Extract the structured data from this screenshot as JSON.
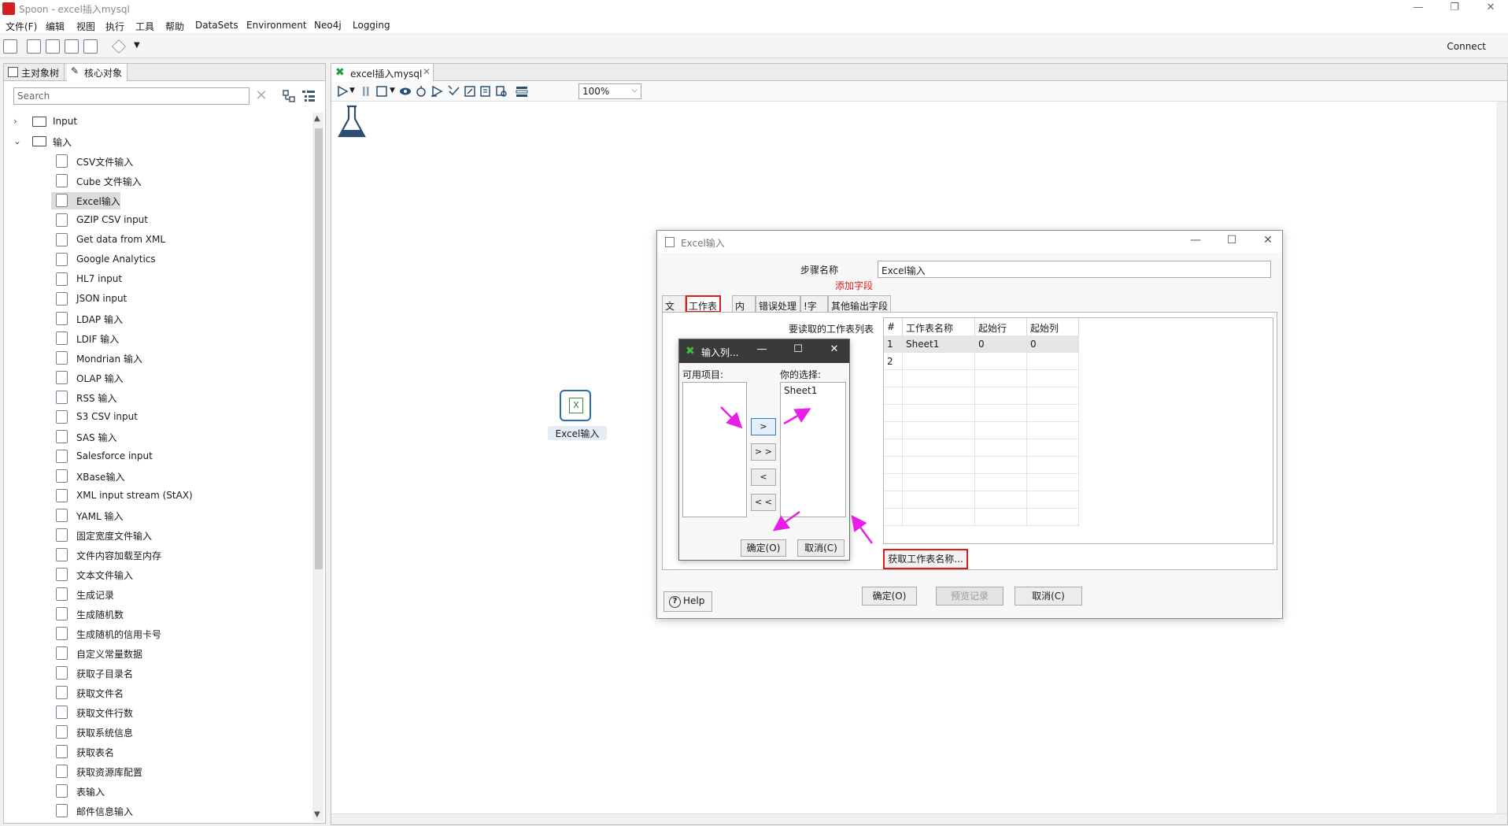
{
  "window": {
    "title": "Spoon - excel插入mysql",
    "logo_color": "#d41f1f"
  },
  "menubar": {
    "items": [
      "文件(F)",
      "编辑",
      "视图",
      "执行",
      "工具",
      "帮助",
      "DataSets",
      "Environment",
      "Neo4j",
      "Logging"
    ]
  },
  "toolbar": {
    "connect_label": "Connect"
  },
  "left_panel": {
    "tabs": [
      "主对象树",
      "核心对象"
    ],
    "search_placeholder": "Search",
    "tree": {
      "folders": [
        "Input",
        "输入"
      ],
      "items": [
        "CSV文件输入",
        "Cube 文件输入",
        "Excel输入",
        "GZIP CSV input",
        "Get data from XML",
        "Google Analytics",
        "HL7 input",
        "JSON input",
        "LDAP 输入",
        "LDIF 输入",
        "Mondrian 输入",
        "OLAP 输入",
        "RSS 输入",
        "S3 CSV input",
        "SAS 输入",
        "Salesforce input",
        "XBase输入",
        "XML input stream (StAX)",
        "YAML 输入",
        "固定宽度文件输入",
        "文件内容加载至内存",
        "文本文件输入",
        "生成记录",
        "生成随机数",
        "生成随机的信用卡号",
        "自定义常量数据",
        "获取子目录名",
        "获取文件名",
        "获取文件行数",
        "获取系统信息",
        "获取表名",
        "获取资源库配置",
        "表输入",
        "邮件信息输入"
      ],
      "selected": "Excel输入"
    }
  },
  "editor": {
    "tab_label": "excel插入mysql",
    "zoom": "100%",
    "step_label": "Excel输入"
  },
  "dialog": {
    "title": "Excel输入",
    "step_name_label": "步骤名称",
    "step_name_value": "Excel输入",
    "add_field_label": "添加字段",
    "tabs": [
      "文件",
      "工作表",
      "内容",
      "错误处理",
      "!字段",
      "其他输出字段"
    ],
    "active_tab": "工作表",
    "sheets_list_label": "要读取的工作表列表",
    "table": {
      "columns": [
        "#",
        "工作表名称",
        "起始行",
        "起始列"
      ],
      "rows": [
        [
          "1",
          "Sheet1",
          "0",
          "0"
        ],
        [
          "2",
          "",
          "",
          ""
        ]
      ]
    },
    "get_sheets_button": "获取工作表名称...",
    "help_button": "Help",
    "ok_button": "确定(O)",
    "preview_button": "预览记录",
    "cancel_button": "取消(C)",
    "accent_color": "#e01b1b"
  },
  "inner_dialog": {
    "title": "输入列...",
    "available_label": "可用项目:",
    "chosen_label": "你的选择:",
    "chosen_items": [
      "Sheet1"
    ],
    "move_buttons": [
      ">",
      "> >",
      "<",
      "< <"
    ],
    "ok_button": "确定(O)",
    "cancel_button": "取消(C)",
    "title_bg": "#3a3a3a"
  },
  "annotations": {
    "arrow_color": "#e81ee8"
  }
}
